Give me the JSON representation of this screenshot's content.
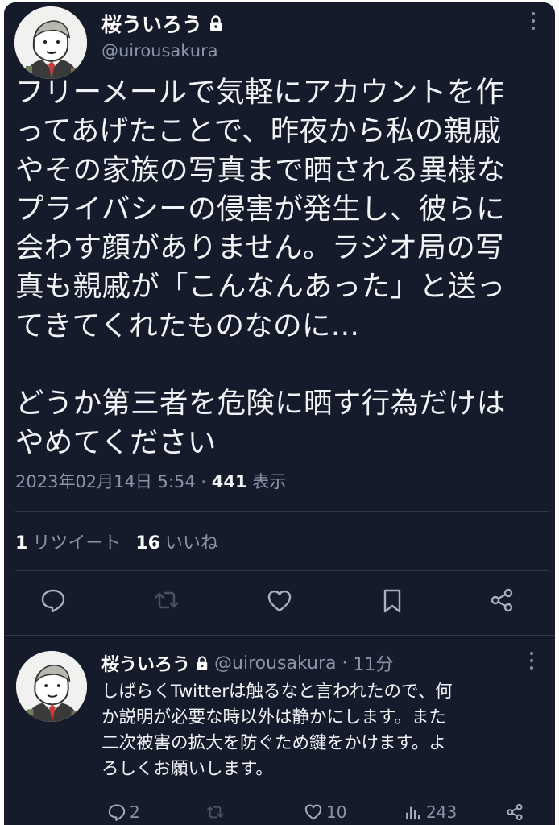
{
  "main_tweet": {
    "author_name": "桜ういろう",
    "handle": "@uirousakura",
    "text": "フリーメールで気軽にアカウントを作\nってあげたことで、昨夜から私の親戚\nやその家族の写真まで晒される異様な\nプライバシーの侵害が発生し、彼らに\n会わす顔がありません。ラジオ局の写\n真も親戚が「こんなんあった」と送っ\nてきてくれたものなのに…\n\nどうか第三者を危険に晒す行為だけは\nやめてください",
    "timestamp": "2023年02月14日 5:54",
    "separator": "·",
    "views_count": "441",
    "views_label": "表示",
    "retweet_count": "1",
    "retweet_label": "リツイート",
    "like_count": "16",
    "like_label": "いいね"
  },
  "reply_tweet": {
    "author_name": "桜ういろう",
    "handle": "@uirousakura",
    "separator": "·",
    "time_ago": "11分",
    "text": "しばらくTwitterは触るなと言われたので、何\nか説明が必要な時以外は静かにします。また\n二次被害の拡大を防ぐため鍵をかけます。よ\nろしくお願いします。",
    "reply_count": "2",
    "like_count": "10",
    "view_count": "243"
  },
  "icons": {
    "lock": "lock-icon",
    "reply": "reply-icon",
    "retweet": "retweet-icon",
    "like": "heart-icon",
    "bookmark": "bookmark-icon",
    "share": "share-icon",
    "views": "views-icon",
    "more": "more-icon"
  },
  "colors": {
    "background": "#151b2a",
    "text": "#f2f3f6",
    "muted": "#8b95a8",
    "retweet_disabled": "#4a5163"
  }
}
